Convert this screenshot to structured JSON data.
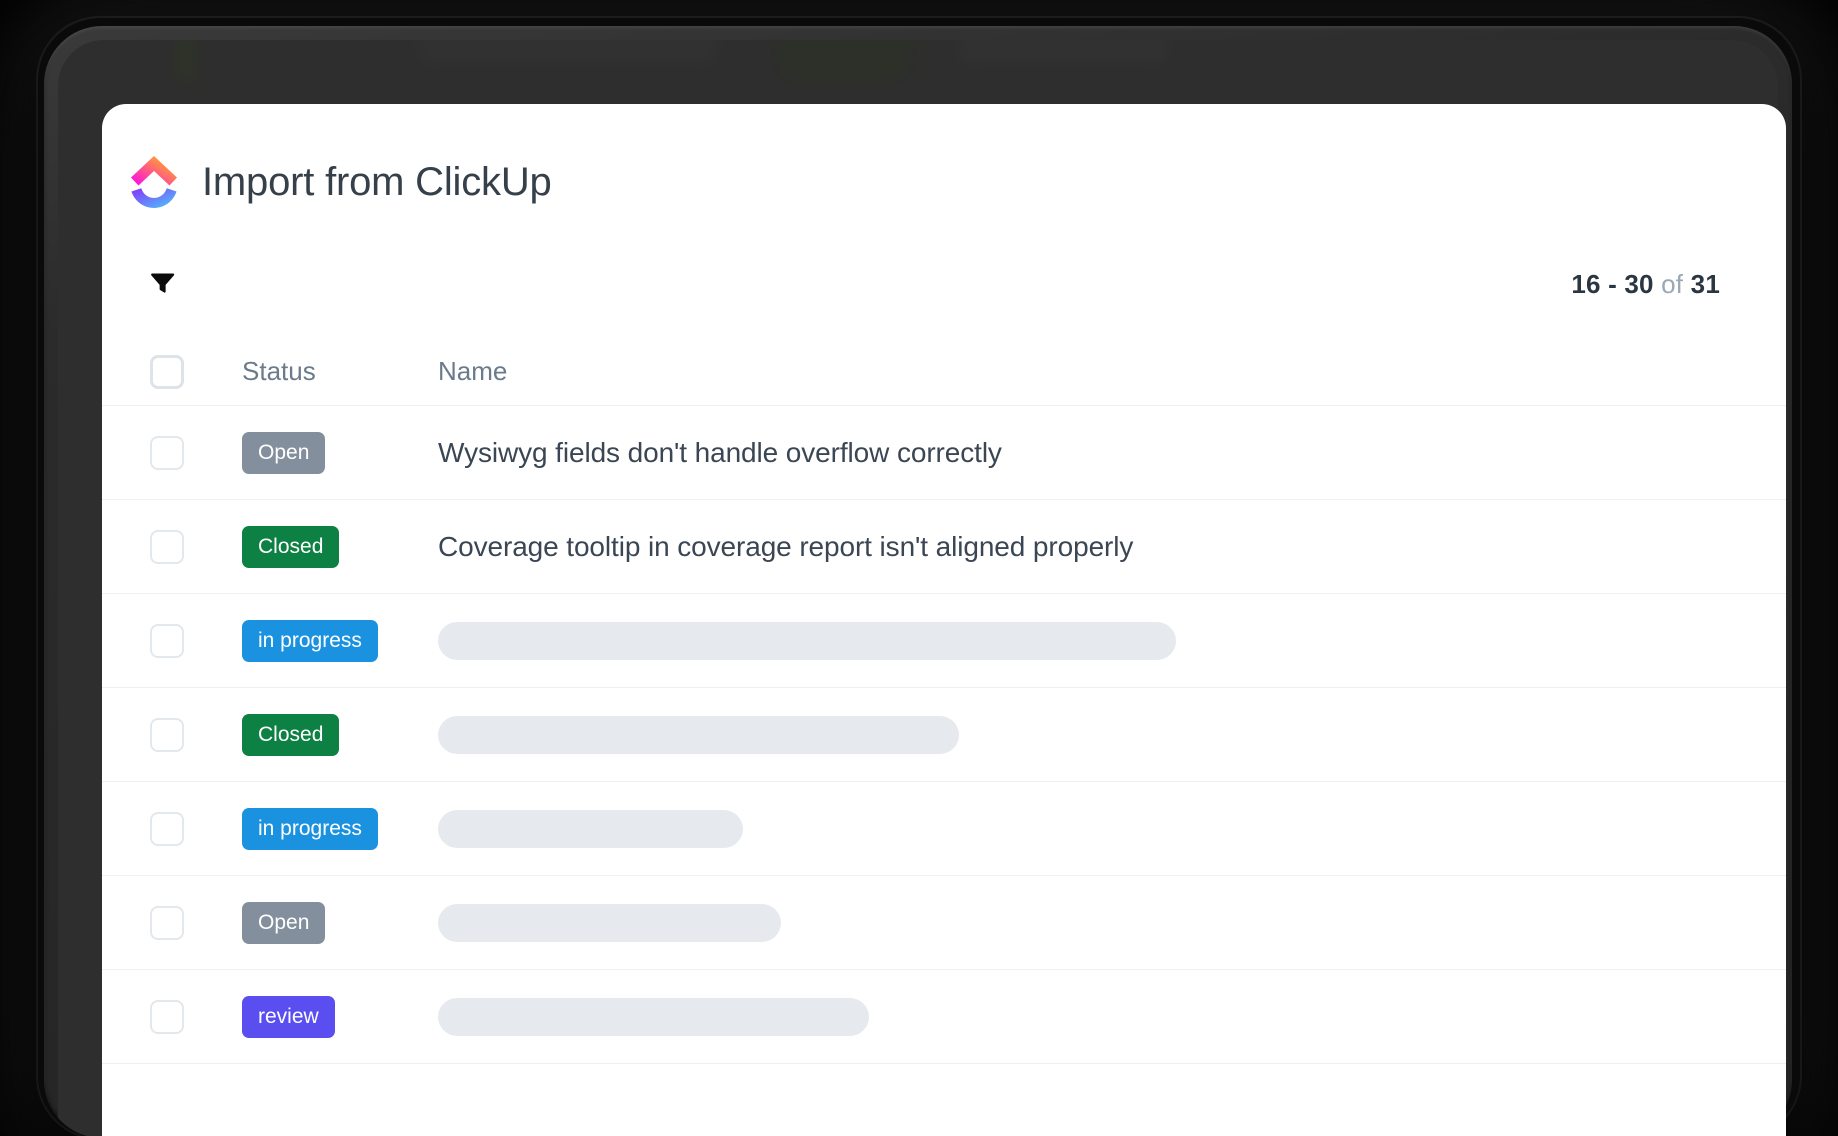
{
  "app": {
    "title": "Import from ClickUp",
    "logo_icon": "clickup-logo-icon",
    "background": "#000000",
    "card_background": "#ffffff"
  },
  "toolbar": {
    "filter_icon": "filter-funnel-icon",
    "pagination": {
      "range": "16 - 30",
      "separator": "of",
      "total": "31",
      "full_text": "16 - 30 of 31"
    }
  },
  "table": {
    "select_all_checkbox": "unchecked",
    "columns": [
      {
        "key": "checkbox",
        "label": ""
      },
      {
        "key": "status",
        "label": "Status"
      },
      {
        "key": "name",
        "label": "Name"
      }
    ],
    "status_colors": {
      "Open": "#848f9d",
      "Closed": "#0d8043",
      "in progress": "#1b92e0",
      "review": "#5a4ef0"
    },
    "rows": [
      {
        "checked": false,
        "status": "Open",
        "status_color": "#848f9d",
        "name": "Wysiwyg fields don't handle overflow correctly",
        "loading": false,
        "skeleton_width": 0
      },
      {
        "checked": false,
        "status": "Closed",
        "status_color": "#0d8043",
        "name": "Coverage tooltip in coverage report isn't aligned properly",
        "loading": false,
        "skeleton_width": 0
      },
      {
        "checked": false,
        "status": "in progress",
        "status_color": "#1b92e0",
        "name": "",
        "loading": true,
        "skeleton_width": 738
      },
      {
        "checked": false,
        "status": "Closed",
        "status_color": "#0d8043",
        "name": "",
        "loading": true,
        "skeleton_width": 521
      },
      {
        "checked": false,
        "status": "in progress",
        "status_color": "#1b92e0",
        "name": "",
        "loading": true,
        "skeleton_width": 305
      },
      {
        "checked": false,
        "status": "Open",
        "status_color": "#848f9d",
        "name": "",
        "loading": true,
        "skeleton_width": 343
      },
      {
        "checked": false,
        "status": "review",
        "status_color": "#5a4ef0",
        "name": "",
        "loading": true,
        "skeleton_width": 431
      }
    ]
  }
}
